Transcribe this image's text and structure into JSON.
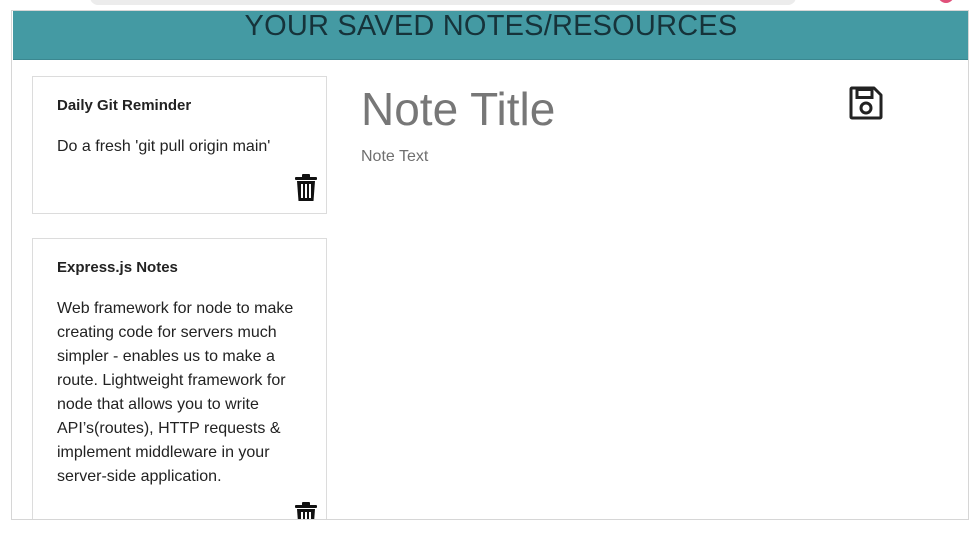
{
  "header": {
    "title": "YOUR SAVED NOTES/RESOURCES"
  },
  "notes": [
    {
      "title": "Daily Git Reminder",
      "text": "Do a fresh 'git pull origin main'",
      "delete_icon": "trash-icon"
    },
    {
      "title": "Express.js Notes",
      "text": "Web framework for node to make creating code for servers much simpler - enables us to make a route. Lightweight framework for node that allows you to write API’s(routes), HTTP requests & implement middleware in your server-side application.",
      "delete_icon": "trash-icon"
    }
  ],
  "editor": {
    "title_placeholder": "Note Title",
    "text_placeholder": "Note Text",
    "title_value": "",
    "text_value": ""
  },
  "toolbar": {
    "save_icon": "floppy-disk-icon"
  },
  "colors": {
    "header_bg": "#449aa3",
    "header_text": "#16333a",
    "card_border": "#dcdcdc",
    "placeholder": "#777777"
  }
}
